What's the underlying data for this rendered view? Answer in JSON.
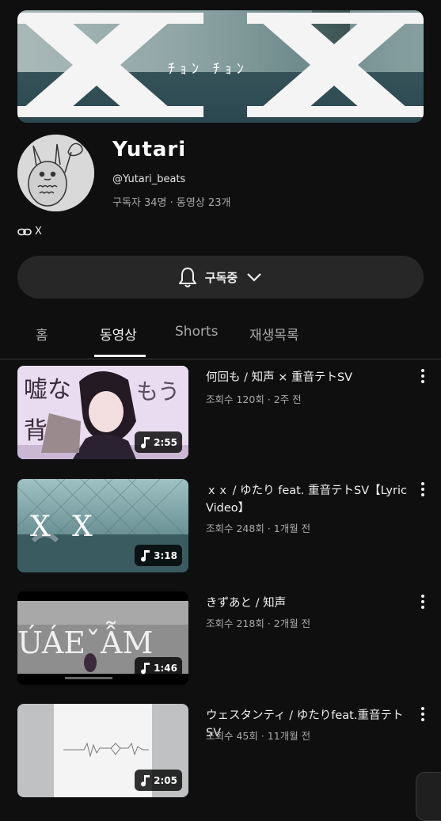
{
  "banner": {
    "text": "ﾁｮﾝ ﾁｮﾝ"
  },
  "channel": {
    "name": "Yutari",
    "handle": "@Yutari_beats",
    "stats": "구독자 34명 · 동영상 23개",
    "link_text": "X"
  },
  "subscribe": {
    "label": "구독중"
  },
  "tabs": [
    {
      "label": "홈"
    },
    {
      "label": "동영상"
    },
    {
      "label": "Shorts"
    },
    {
      "label": "재생목록"
    }
  ],
  "videos": [
    {
      "title": "何回も / 知声 × 重音テトSV",
      "meta": "조회수 120회 · 2주 전",
      "duration": "2:55",
      "thumb_text_1": "嘘な",
      "thumb_text_2": "もう",
      "thumb_text_3": "背"
    },
    {
      "title": "ｘｘ / ゆたり feat. 重音テトSV【Lyric Video】",
      "meta": "조회수 248회 · 1개월 전",
      "duration": "3:18",
      "thumb_text_1": "X X"
    },
    {
      "title": "きずあと / 知声",
      "meta": "조회수 218회 · 2개월 전",
      "duration": "1:46",
      "thumb_text_1": "ÚÁEˇẪM"
    },
    {
      "title": "ウェスタンティ / ゆたりfeat.重音テトSV",
      "meta": "조회수 45회 · 11개월 전",
      "duration": "2:05"
    }
  ],
  "icons": {
    "link": "link-icon",
    "bell": "bell-icon",
    "chevron": "chevron-down-icon",
    "music": "music-note-icon",
    "more": "more-vert-icon"
  }
}
